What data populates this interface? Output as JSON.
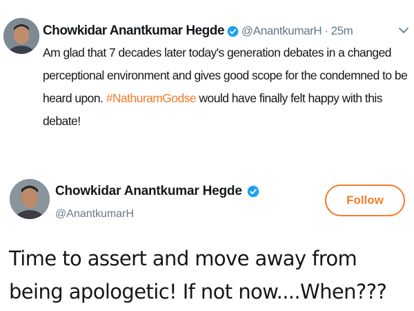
{
  "tweet1": {
    "author_name": "Chowkidar Anantkumar Hegde",
    "handle": "@AnantkumarH",
    "separator": "·",
    "time": "25m",
    "text_before": "Am glad that 7 decades later today's generation debates in a changed perceptional environment and gives good scope for the  condemned to be heard upon. ",
    "hashtag": "#NathuramGodse",
    "text_after": " would have finally felt happy with this debate!",
    "icons": {
      "verified": "verified-badge-icon",
      "menu": "chevron-down-icon"
    }
  },
  "tweet2": {
    "author_name": "Chowkidar Anantkumar Hegde",
    "handle": "@AnantkumarH",
    "follow_label": "Follow",
    "text": "Time to assert and move away from being apologetic!  If not now....When???",
    "icons": {
      "verified": "verified-badge-icon"
    }
  },
  "colors": {
    "accent": "#f47c2b",
    "verified": "#1da1f2",
    "secondary_text": "#657786",
    "primary_text": "#14171a"
  }
}
